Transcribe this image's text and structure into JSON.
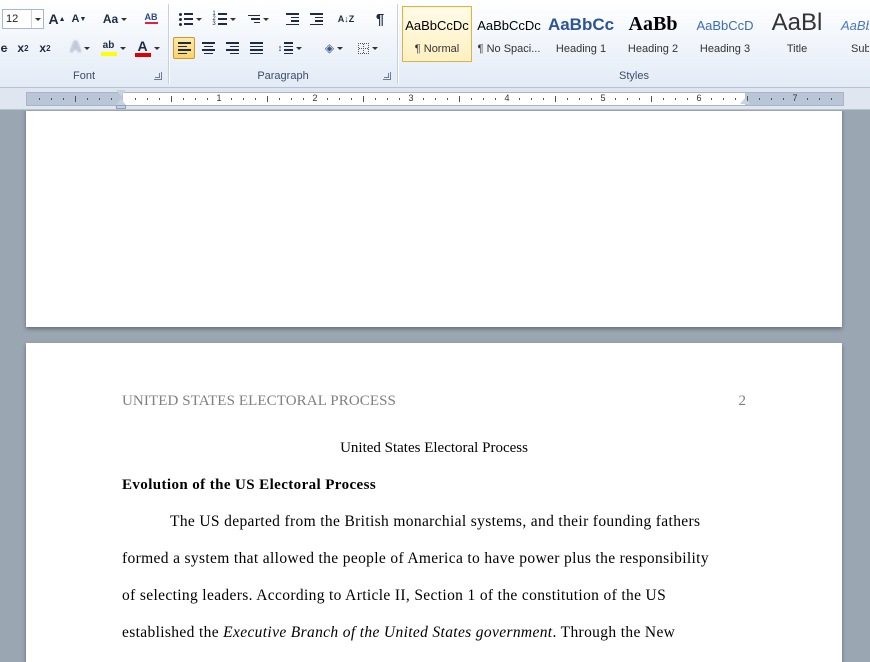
{
  "ribbon": {
    "font_group": {
      "label": "Font",
      "font_size": "12",
      "grow_label": "A",
      "shrink_label": "A",
      "case_label": "Aa",
      "clear_format_label": "AB",
      "strike_label": "abc",
      "subscript_label": "x",
      "superscript_label": "x",
      "text_effects_label": "A",
      "highlight_label": "ab",
      "font_color_label": "A",
      "highlight_color": "#ffff00",
      "font_color": "#e00000"
    },
    "paragraph_group": {
      "label": "Paragraph",
      "pilcrow": "¶",
      "sort_label": "A↓Z"
    },
    "styles_group": {
      "label": "Styles",
      "styles": [
        {
          "sample": "AaBbCcDc",
          "name": "¶ Normal"
        },
        {
          "sample": "AaBbCcDc",
          "name": "¶ No Spaci..."
        },
        {
          "sample": "AaBbCc",
          "name": "Heading 1"
        },
        {
          "sample": "AaBb",
          "name": "Heading 2"
        },
        {
          "sample": "AaBbCcD",
          "name": "Heading 3"
        },
        {
          "sample": "AaBl",
          "name": "Title"
        },
        {
          "sample": "AaBb",
          "name": "Sub"
        }
      ]
    }
  },
  "ruler": {
    "numbers": [
      "1",
      "2",
      "3",
      "4",
      "5",
      "6",
      "7"
    ]
  },
  "document": {
    "header_title": "UNITED STATES ELECTORAL PROCESS",
    "page_number": "2",
    "title": "United States Electoral Process",
    "heading": "Evolution of the US Electoral Process",
    "lines": [
      "The US departed from the British monarchial systems, and their founding fathers",
      "formed a system that allowed the people of America to have power plus the responsibility",
      "of selecting leaders. According to Article II, Section 1 of the constitution of the US"
    ],
    "line4_start": "established the ",
    "line4_italic": "Executive Branch of the United States government",
    "line4_end": ". Through the New"
  }
}
